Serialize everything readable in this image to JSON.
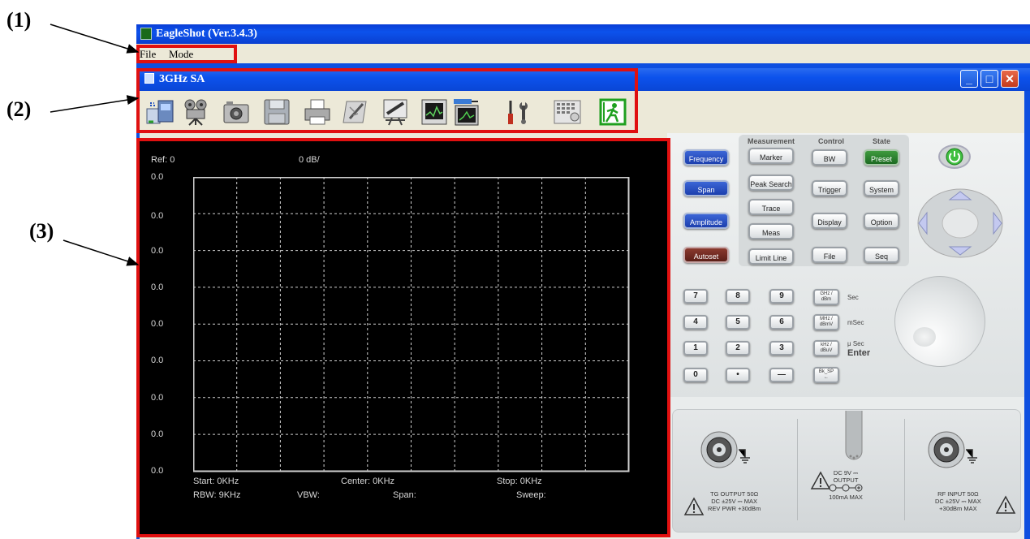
{
  "annotations": {
    "label1": "(1)",
    "label2": "(2)",
    "label3": "(3)"
  },
  "app": {
    "title": "EagleShot (Ver.3.4.3)"
  },
  "menu": {
    "file": "File",
    "mode": "Mode"
  },
  "child": {
    "title": "3GHz SA",
    "controls": {
      "minimize": "_",
      "maximize": "□",
      "close": "✕"
    }
  },
  "toolbar": {
    "icons": [
      "connect-icon",
      "video-record-icon",
      "camera-icon",
      "save-icon",
      "print-icon",
      "edit-icon",
      "chalkboard-icon",
      "chip-signal-icon",
      "wrench-screwdriver-icon",
      "keyboard-icon",
      "exit-icon"
    ]
  },
  "screen": {
    "ref": "Ref: 0",
    "scale": "0 dB/",
    "ylabels": [
      "0.0",
      "0.0",
      "0.0",
      "0.0",
      "0.0",
      "0.0",
      "0.0",
      "0.0",
      "0.0"
    ],
    "start": "Start: 0KHz",
    "center": "Center: 0KHz",
    "stop": "Stop: 0KHz",
    "rbw": "RBW: 9KHz",
    "vbw": "VBW:",
    "span": "Span:",
    "sweep": "Sweep:"
  },
  "panel": {
    "headers": {
      "measurement": "Measurement",
      "control": "Control",
      "state": "State"
    },
    "left": [
      "Frequency",
      "Span",
      "Amplitude",
      "Autoset"
    ],
    "measurement": [
      "Marker",
      "Peak Search",
      "Trace",
      "Meas",
      "Limit Line"
    ],
    "control": [
      "BW",
      "Trigger",
      "Display",
      "File"
    ],
    "state": [
      "Preset",
      "System",
      "Option",
      "Seq"
    ],
    "keys": [
      [
        "7",
        "8",
        "9"
      ],
      [
        "4",
        "5",
        "6"
      ],
      [
        "1",
        "2",
        "3"
      ],
      [
        "0",
        "•",
        "—"
      ]
    ],
    "units": [
      [
        "GHz /",
        "dBm"
      ],
      [
        "MHz /",
        "dBmV"
      ],
      [
        "kHz /",
        "dBuV"
      ],
      [
        "Bk_SP",
        "←"
      ]
    ],
    "unit_labels": [
      "Sec",
      "mSec",
      "μ Sec"
    ],
    "enter": "Enter",
    "tg_output": [
      "TG  OUTPUT  50Ω",
      "DC ±25V ⎓ MAX",
      "REV  PWR +30dBm"
    ],
    "dc_output": [
      "DC  9V ⎓",
      "OUTPUT",
      "100mA  MAX"
    ],
    "rf_input": [
      "RF  INPUT  50Ω",
      "DC ±25V ⎓ MAX",
      "+30dBm   MAX"
    ]
  },
  "colors": {
    "accent_red": "#e01010",
    "titlebar_blue": "#0c52ec",
    "screen_bg": "#000000"
  }
}
